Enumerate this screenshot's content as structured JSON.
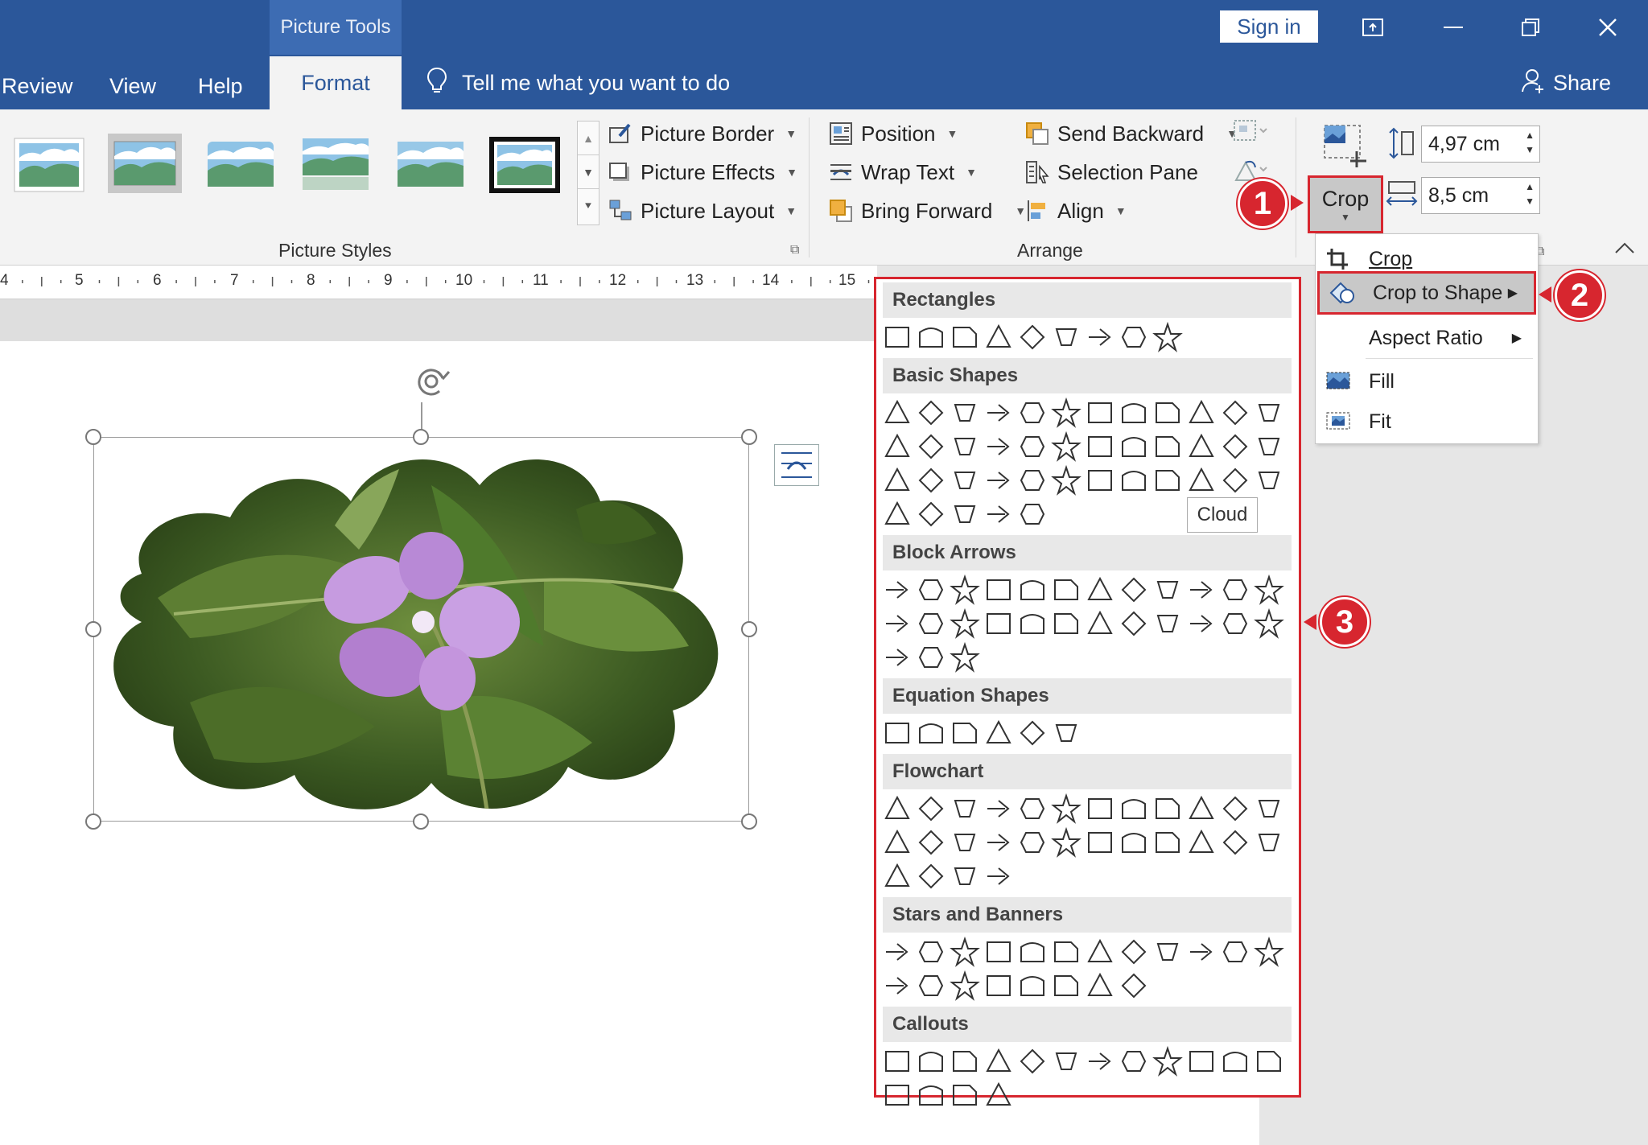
{
  "titlebar": {
    "context_tab": "Picture Tools",
    "sign_in": "Sign in",
    "tabs": [
      {
        "label": "Review",
        "active": false
      },
      {
        "label": "View",
        "active": false
      },
      {
        "label": "Help",
        "active": false
      },
      {
        "label": "Format",
        "active": true
      }
    ],
    "tell_me": "Tell me what you want to do",
    "share": "Share"
  },
  "ribbon": {
    "picture_styles": {
      "label": "Picture Styles",
      "commands": [
        "Picture Border",
        "Picture Effects",
        "Picture Layout"
      ]
    },
    "arrange": {
      "label": "Arrange",
      "col1": [
        "Position",
        "Wrap Text",
        "Bring Forward"
      ],
      "col2": [
        "Send Backward",
        "Selection Pane",
        "Align"
      ]
    },
    "size": {
      "crop_label": "Crop",
      "height": "4,97 cm",
      "width": "8,5 cm"
    }
  },
  "ruler": {
    "numbers": [
      "4",
      "5",
      "6",
      "7",
      "8",
      "9",
      "10",
      "11",
      "12",
      "13",
      "14",
      "15"
    ]
  },
  "crop_menu": {
    "items": [
      {
        "label": "Crop",
        "submenu": false
      },
      {
        "label": "Crop to Shape",
        "submenu": true,
        "highlighted": true
      },
      {
        "label": "Aspect Ratio",
        "submenu": true
      },
      {
        "label": "Fill",
        "submenu": false
      },
      {
        "label": "Fit",
        "submenu": false
      }
    ]
  },
  "shapes_panel": {
    "sections": [
      {
        "title": "Rectangles",
        "rows": [
          9
        ]
      },
      {
        "title": "Basic Shapes",
        "rows": [
          12,
          12,
          12,
          5
        ]
      },
      {
        "title": "Block Arrows",
        "rows": [
          12,
          12,
          3
        ]
      },
      {
        "title": "Equation Shapes",
        "rows": [
          6
        ]
      },
      {
        "title": "Flowchart",
        "rows": [
          12,
          12,
          4
        ]
      },
      {
        "title": "Stars and Banners",
        "rows": [
          12,
          8
        ]
      },
      {
        "title": "Callouts",
        "rows": [
          12,
          4
        ]
      }
    ],
    "tooltip": "Cloud"
  },
  "callouts": [
    "1",
    "2",
    "3"
  ],
  "colors": {
    "title_blue": "#2b579a",
    "annotation_red": "#d7262f",
    "ribbon_bg": "#f3f3f3"
  }
}
